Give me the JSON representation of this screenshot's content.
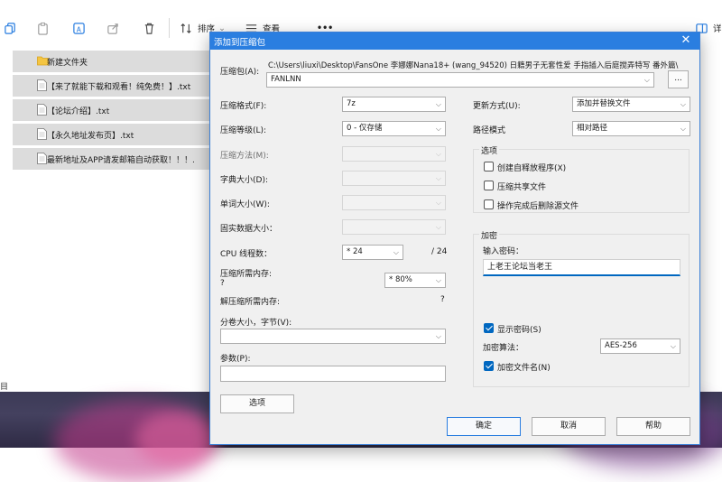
{
  "explorer": {
    "toolbar": {
      "sort_label": "排序",
      "view_label": "查看",
      "more_label": "•••",
      "details_label": "详"
    },
    "files": [
      {
        "name": "新建文件夹",
        "type": "folder"
      },
      {
        "name": "【来了就能下载和观看！纯免费！】.txt",
        "type": "file"
      },
      {
        "name": "【论坛介绍】.txt",
        "type": "file"
      },
      {
        "name": "【永久地址发布页】.txt",
        "type": "file"
      },
      {
        "name": "最新地址及APP请发邮箱自动获取！！！.",
        "type": "file"
      }
    ],
    "status_left": "目"
  },
  "dialog": {
    "title": "添加到压缩包",
    "close_label": "✕",
    "archive": {
      "label": "压缩包(A):",
      "path": "C:\\Users\\liuxi\\Desktop\\FansOne 李娜娜Nana18+ (wang_94520) 日籍男子无套性爱 手指插入后庭搅弄特写 番外篇\\",
      "name_value": "FANLNN",
      "browse_label": "..."
    },
    "left": {
      "format": {
        "label": "压缩格式(F):",
        "value": "7z"
      },
      "level": {
        "label": "压缩等级(L):",
        "value": "0 - 仅存储"
      },
      "method": {
        "label": "压缩方法(M):",
        "value": ""
      },
      "dict": {
        "label": "字典大小(D):",
        "value": ""
      },
      "word": {
        "label": "单词大小(W):",
        "value": ""
      },
      "solid": {
        "label": "固实数据大小：",
        "value": ""
      },
      "threads": {
        "label": "CPU 线程数：",
        "value": "* 24",
        "total": "/ 24"
      },
      "mem_compress": {
        "label": "压缩所需内存:",
        "value": "?",
        "select": "* 80%"
      },
      "mem_decompress": {
        "label": "解压缩所需内存:",
        "value": "?"
      },
      "volume": {
        "label": "分卷大小，字节(V):",
        "value": ""
      },
      "params": {
        "label": "参数(P):",
        "value": ""
      },
      "options_button": "选项"
    },
    "right": {
      "update": {
        "label": "更新方式(U):",
        "value": "添加并替换文件"
      },
      "path_mode": {
        "label": "路径模式",
        "value": "相对路径"
      },
      "options_title": "选项",
      "options": [
        {
          "label": "创建自释放程序(X)",
          "checked": false
        },
        {
          "label": "压缩共享文件",
          "checked": false
        },
        {
          "label": "操作完成后删除源文件",
          "checked": false
        }
      ],
      "encryption": {
        "title": "加密",
        "password_label": "输入密码：",
        "password_value": "上老王论坛当老王",
        "show_password": {
          "label": "显示密码(S)",
          "checked": true
        },
        "method_label": "加密算法：",
        "method_value": "AES-256",
        "encrypt_names": {
          "label": "加密文件名(N)",
          "checked": true
        }
      }
    },
    "buttons": {
      "ok": "确定",
      "cancel": "取消",
      "help": "帮助"
    }
  }
}
